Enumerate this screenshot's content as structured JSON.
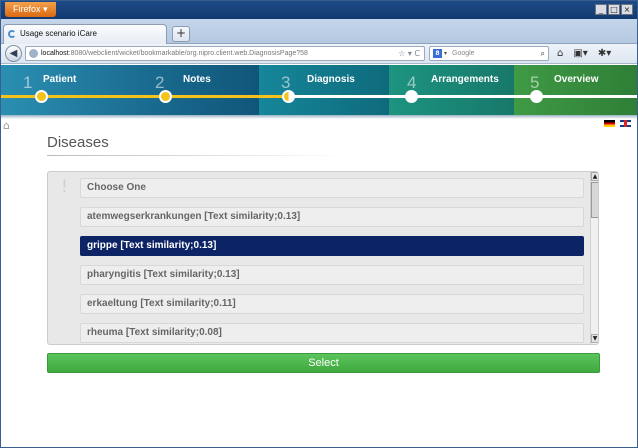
{
  "browser": {
    "menu_button": "Firefox",
    "window_controls": [
      "_",
      "□",
      "×"
    ],
    "tab_title": "Usage scenario iCare",
    "new_tab": "+",
    "url_host": "localhost",
    "url_rest": ":8080/webclient/wicket/bookmarkable/org.nipro.client.web.DiagnosisPage?58",
    "url_icons": "☆ ▾ C",
    "search_engine_icon": "8",
    "search_dropdown": "▾",
    "search_placeholder": "Google",
    "search_icon": "⌕",
    "back": "◀",
    "nav_icons": [
      "⌂",
      "▣▾",
      "✱▾"
    ]
  },
  "wizard": {
    "steps": [
      {
        "num": "1",
        "label": "Patient",
        "state": "done"
      },
      {
        "num": "2",
        "label": "Notes",
        "state": "done"
      },
      {
        "num": "3",
        "label": "Diagnosis",
        "state": "current"
      },
      {
        "num": "4",
        "label": "Arrangements",
        "state": "todo"
      },
      {
        "num": "5",
        "label": "Overview",
        "state": "todo"
      }
    ],
    "colors": {
      "done_line": "#f3c21b",
      "todo_line": "#ffffff",
      "done_dot": "#f3c21b",
      "todo_dot": "#ffffff"
    }
  },
  "page": {
    "home_icon": "home-icon",
    "title": "Diseases",
    "warn_icon": "!",
    "options": [
      {
        "label": "Choose One",
        "selected": false
      },
      {
        "label": "atemwegserkrankungen [Text similarity;0.13]",
        "selected": false
      },
      {
        "label": "grippe [Text similarity;0.13]",
        "selected": true
      },
      {
        "label": "pharyngitis [Text similarity;0.13]",
        "selected": false
      },
      {
        "label": "erkaeltung [Text similarity;0.11]",
        "selected": false
      },
      {
        "label": "rheuma [Text similarity;0.08]",
        "selected": false
      }
    ],
    "scroll_up": "▲",
    "scroll_down": "▼",
    "select_button": "Select",
    "accent_color": "#4cb34c",
    "selected_color": "#0c2466"
  }
}
